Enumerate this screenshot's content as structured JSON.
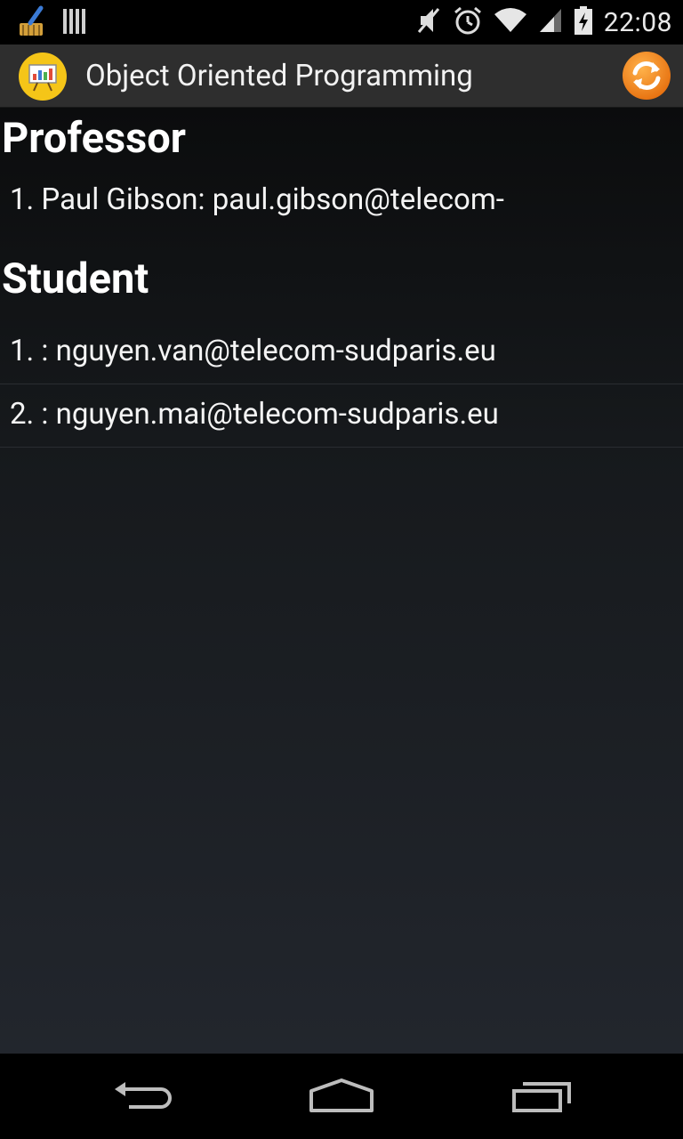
{
  "status_bar": {
    "time": "22:08",
    "left_icons": [
      "broom-icon",
      "barcode-icon"
    ],
    "right_icons": [
      "mute-icon",
      "alarm-icon",
      "wifi-icon",
      "signal-icon",
      "battery-charging-icon"
    ]
  },
  "action_bar": {
    "title": "Object Oriented Programming",
    "app_icon": "presentation-board-icon",
    "refresh_icon": "refresh-icon"
  },
  "professor_section": {
    "header": "Professor",
    "items": [
      "1. Paul Gibson: paul.gibson@telecom-"
    ]
  },
  "student_section": {
    "header": "Student",
    "items": [
      "1. : nguyen.van@telecom-sudparis.eu",
      "2. : nguyen.mai@telecom-sudparis.eu"
    ]
  },
  "nav_bar": {
    "icons": [
      "back-icon",
      "home-icon",
      "recent-apps-icon"
    ]
  },
  "colors": {
    "accent_orange": "#f28a1e",
    "app_icon_yellow": "#f5c518",
    "action_bar_bg": "#2e2e2e"
  }
}
